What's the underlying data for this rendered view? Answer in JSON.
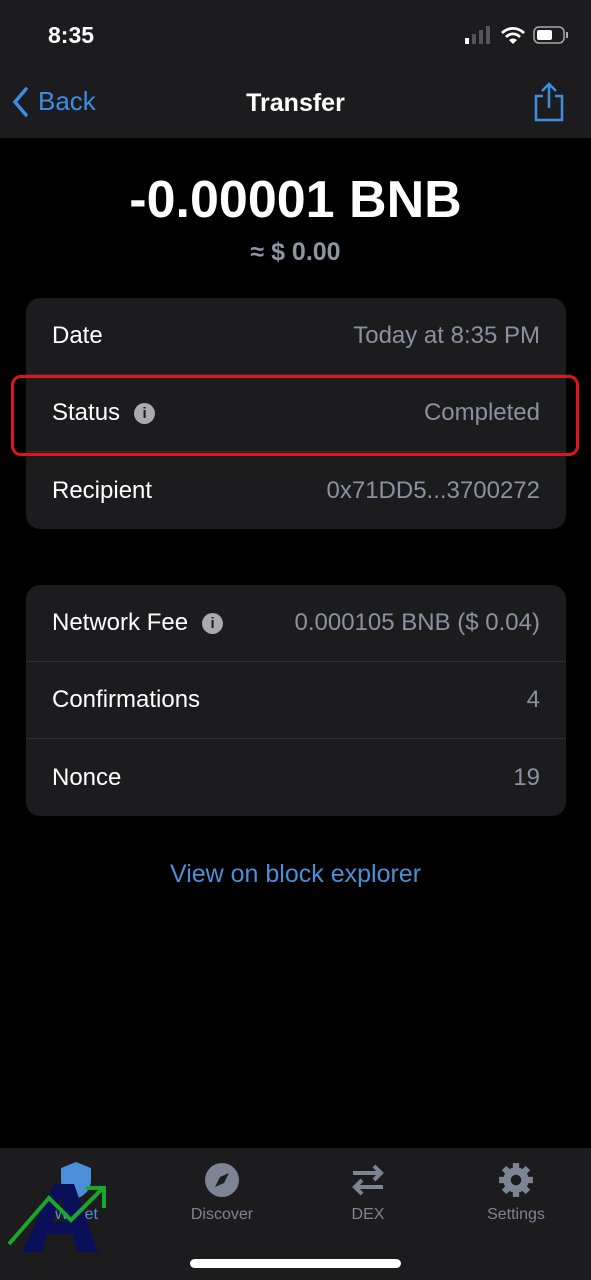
{
  "status_bar": {
    "time": "8:35"
  },
  "nav": {
    "back_label": "Back",
    "title": "Transfer"
  },
  "amount": {
    "value": "-0.00001 BNB",
    "fiat": "≈ $ 0.00"
  },
  "details": [
    {
      "label": "Date",
      "value": "Today at 8:35 PM"
    },
    {
      "label": "Status",
      "value": "Completed",
      "info": true
    },
    {
      "label": "Recipient",
      "value": "0x71DD5...3700272"
    }
  ],
  "fees": [
    {
      "label": "Network Fee",
      "value": "0.000105 BNB ($ 0.04)",
      "info": true
    },
    {
      "label": "Confirmations",
      "value": "4"
    },
    {
      "label": "Nonce",
      "value": "19"
    }
  ],
  "explorer_link": "View on block explorer",
  "tabs": [
    {
      "label": "Wallet",
      "icon": "shield-icon",
      "active": true
    },
    {
      "label": "Discover",
      "icon": "compass-icon"
    },
    {
      "label": "DEX",
      "icon": "swap-arrows-icon"
    },
    {
      "label": "Settings",
      "icon": "gear-icon"
    }
  ],
  "colors": {
    "accent": "#3e8ee0",
    "highlight": "#e0141c"
  },
  "watermark": {
    "text": "A"
  }
}
